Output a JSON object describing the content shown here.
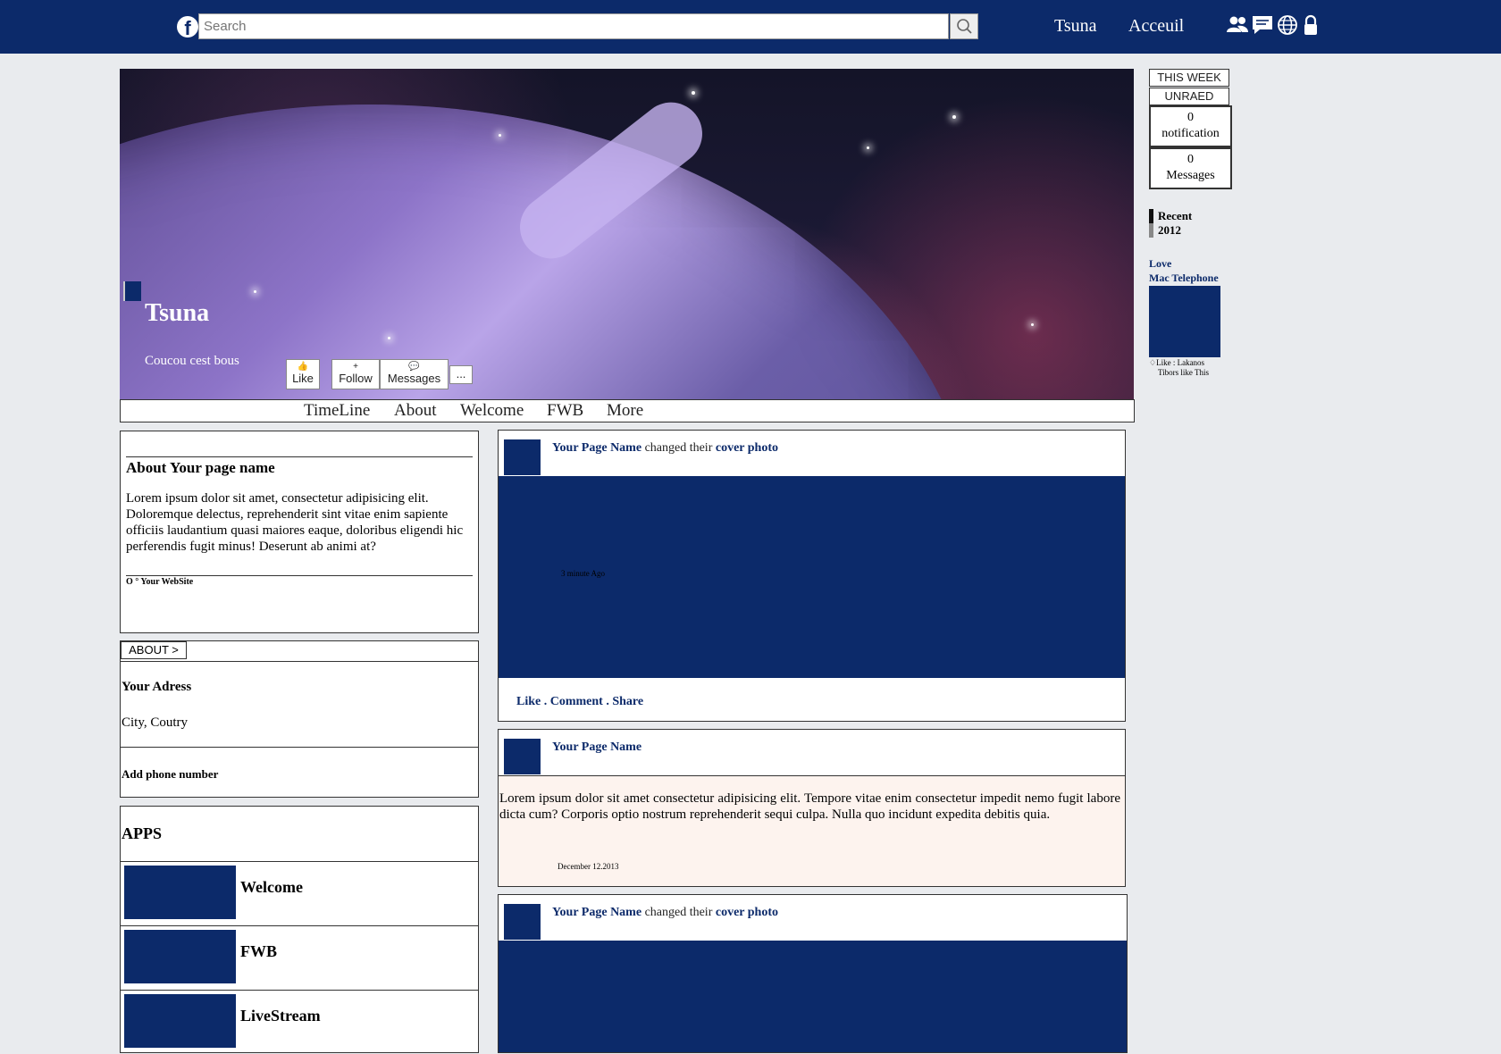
{
  "topbar": {
    "search_placeholder": "Search",
    "nav": [
      "Tsuna",
      "Acceuil"
    ],
    "icons": [
      "friends-icon",
      "messages-icon",
      "globe-icon",
      "lock-icon"
    ]
  },
  "cover": {
    "name": "Tsuna",
    "bio": "Coucou cest bous",
    "buttons": [
      {
        "icon": "👍",
        "label": "Like"
      },
      {
        "icon": "+",
        "label": "Follow"
      },
      {
        "icon": "💬",
        "label": "Messages"
      },
      {
        "icon": "",
        "label": "..."
      }
    ]
  },
  "tabs": [
    "TimeLine",
    "About",
    "Welcome",
    "FWB",
    "More"
  ],
  "about_box": {
    "title": "About Your page name",
    "text": "Lorem ipsum dolor sit amet, consectetur adipisicing elit. Doloremque delectus, reprehenderit sint vitae enim sapiente officiis laudantium quasi maiores eaque, doloribus eligendi hic perferendis fugit minus! Deserunt ab animi at?",
    "website": "O ° Your WebSite"
  },
  "info_box": {
    "tab": "ABOUT >",
    "address_label": "Your Adress",
    "address_value": "City, Coutry",
    "phone": "Add phone number"
  },
  "apps": {
    "title": "APPS",
    "items": [
      "Welcome",
      "FWB",
      "LiveStream"
    ]
  },
  "posts": [
    {
      "author": "Your Page Name",
      "action": "changed their",
      "object": "cover photo",
      "time": "3 minute Ago",
      "actions": "Like . Comment . Share"
    },
    {
      "author": "Your Page Name",
      "text": "Lorem ipsum dolor sit amet consectetur adipisicing elit. Tempore vitae enim consectetur impedit nemo fugit labore dicta cum? Corporis optio nostrum reprehenderit sequi culpa. Nulla quo incidunt expedita debitis quia.",
      "date": "December 12.2013"
    },
    {
      "author": "Your Page Name",
      "action": "changed their",
      "object": "cover photo"
    }
  ],
  "sidebar": {
    "tabs": [
      "THIS WEEK",
      "UNRAED"
    ],
    "notifications_count": "0",
    "notifications_label": "notification",
    "messages_count": "0",
    "messages_label": "Messages",
    "years": [
      "Recent",
      "2012"
    ],
    "links": [
      "Love",
      "Mac Telephone"
    ],
    "likes_line1": "Like : Lakanos",
    "likes_line2": "Tibors like This"
  },
  "colors": {
    "brand": "#0c2a6a",
    "page_bg": "#e9ebee",
    "post_tint": "#fdf3ee"
  }
}
